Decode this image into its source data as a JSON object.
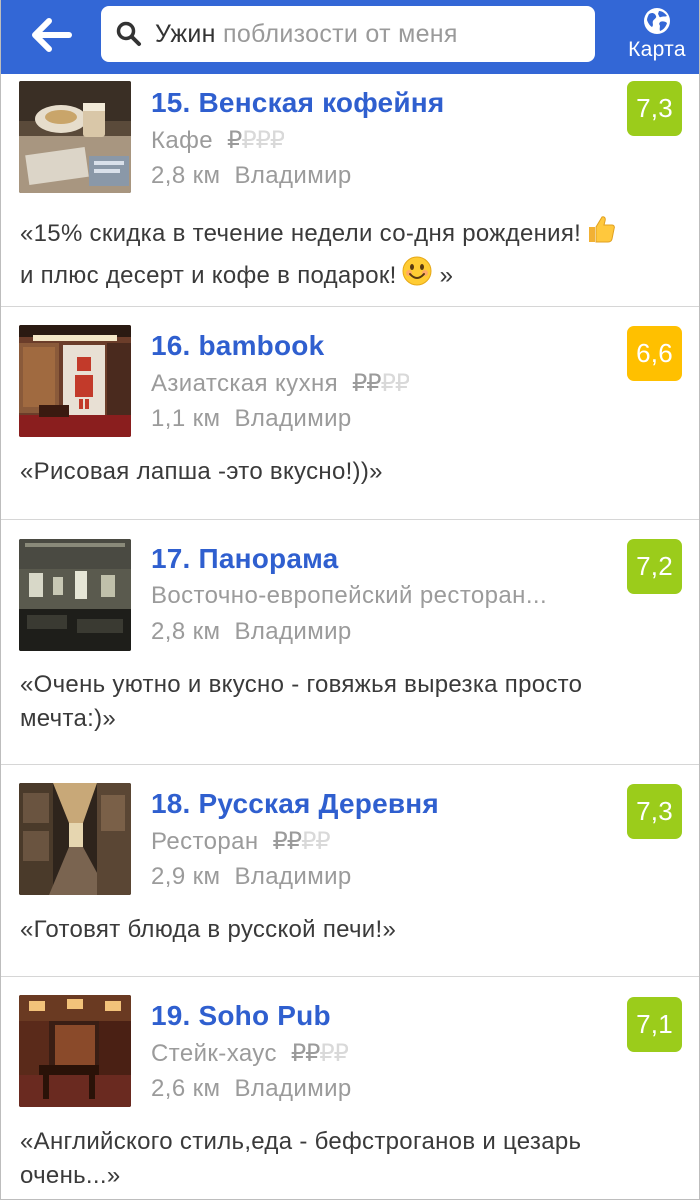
{
  "header": {
    "search_query": "Ужин",
    "search_suffix": " поблизости от меня",
    "map_label": "Карта"
  },
  "colors": {
    "header_bg": "#3367d6",
    "title": "#2f5fcf",
    "rating_green": "#9bcc1b",
    "rating_orange": "#ffc000"
  },
  "venues": [
    {
      "title": "15. Венская кофейня",
      "category": "Кафе",
      "price_on": "₽",
      "price_off": "₽₽₽",
      "distance": "2,8 км",
      "city": "Владимир",
      "rating": "7,3",
      "tip_line1": "«15% скидка в течение недели со-дня рождения!",
      "tip_line2": "и плюс десерт и кофе в подарок!",
      "tip_end": "»"
    },
    {
      "title": "16. bambook",
      "category": "Азиатская кухня",
      "price_on": "₽₽",
      "price_off": "₽₽",
      "distance": "1,1 км",
      "city": "Владимир",
      "rating": "6,6",
      "tip_line1": "«Рисовая лапша -это вкусно!))»"
    },
    {
      "title": "17. Панорама",
      "category": "Восточно-европейский ресторан...",
      "distance": "2,8 км",
      "city": "Владимир",
      "rating": "7,2",
      "tip_line1": "«Очень уютно и вкусно - говяжья вырезка просто",
      "tip_line2": "мечта:)»"
    },
    {
      "title": "18. Русская Деревня",
      "category": "Ресторан",
      "price_on": "₽₽",
      "price_off": "₽₽",
      "distance": "2,9 км",
      "city": "Владимир",
      "rating": "7,3",
      "tip_line1": "«Готовят блюда в русской печи!»"
    },
    {
      "title": "19. Soho Pub",
      "category": "Стейк-хаус",
      "price_on": "₽₽",
      "price_off": "₽₽",
      "distance": "2,6 км",
      "city": "Владимир",
      "rating": "7,1",
      "tip_line1": "«Английского стиль,еда - бефстроганов и цезарь",
      "tip_line2": "очень...»"
    }
  ]
}
